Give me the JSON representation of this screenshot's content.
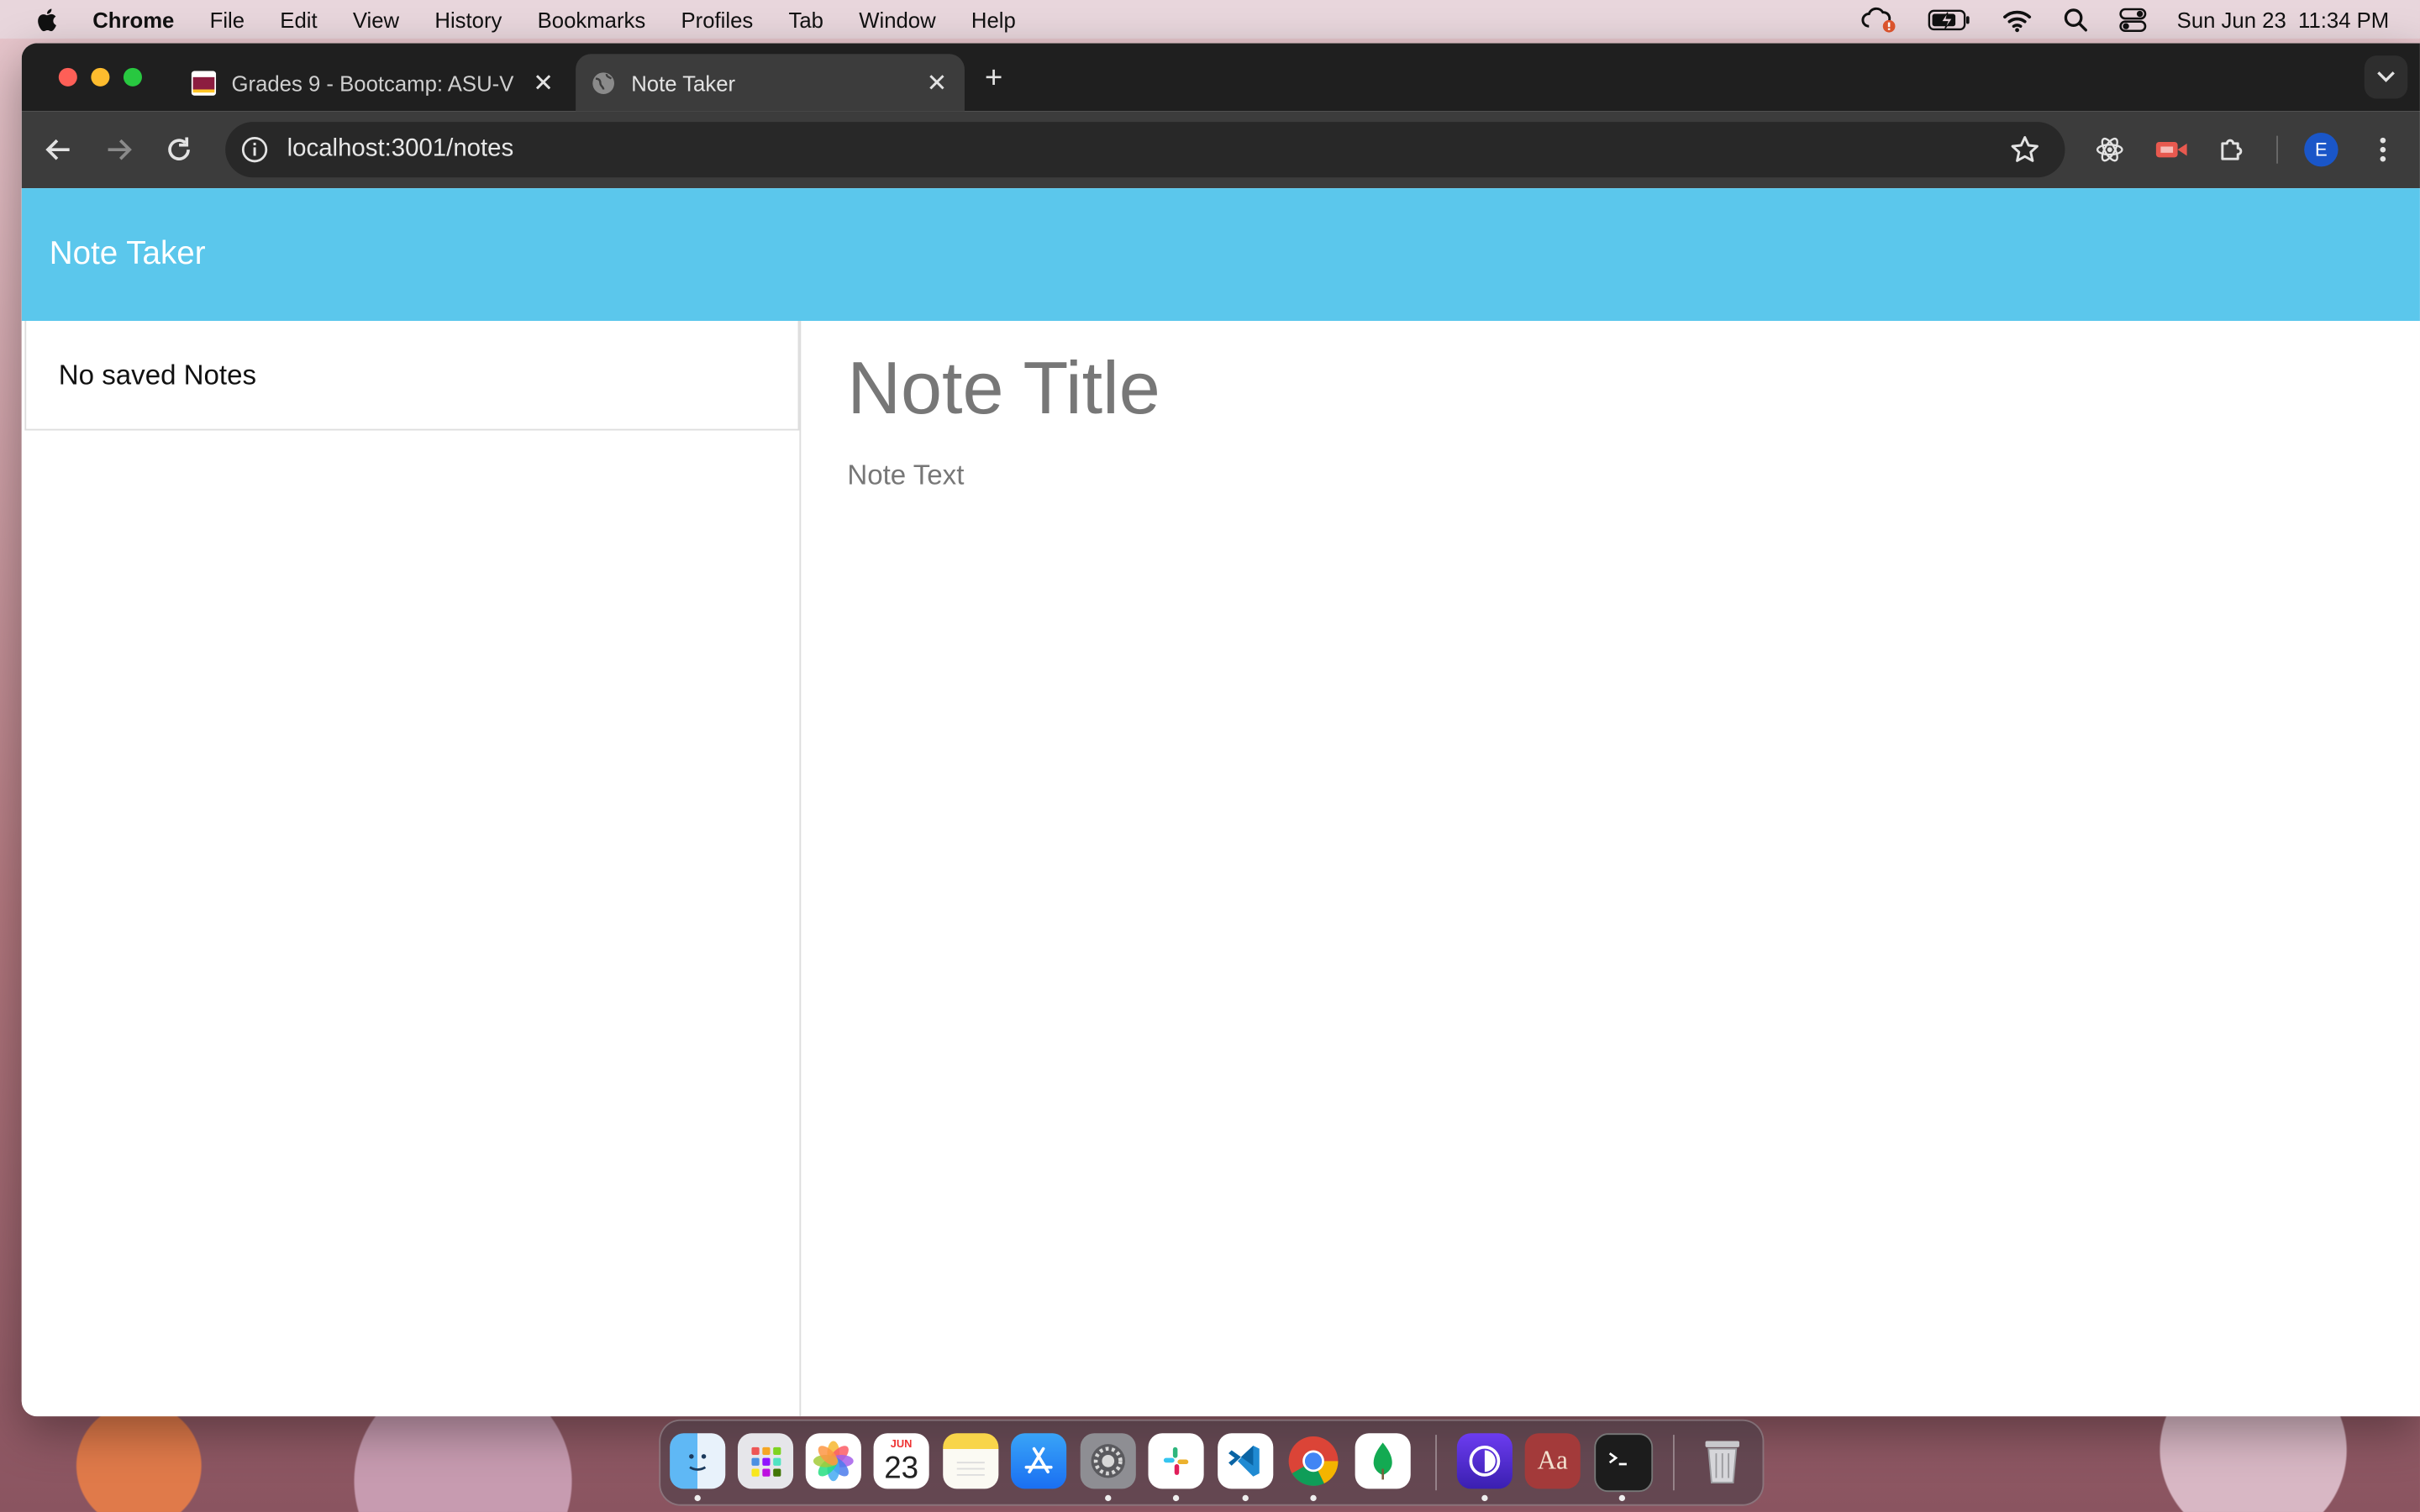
{
  "menubar": {
    "app_name": "Chrome",
    "items": [
      "File",
      "Edit",
      "View",
      "History",
      "Bookmarks",
      "Profiles",
      "Tab",
      "Window",
      "Help"
    ],
    "datetime": "Sun Jun 23  11:34 PM"
  },
  "tabs": [
    {
      "title": "Grades 9 - Bootcamp: ASU-V",
      "favicon": "asu-favicon",
      "active": false
    },
    {
      "title": "Note Taker",
      "favicon": "globe-icon",
      "active": true
    }
  ],
  "toolbar": {
    "url": "localhost:3001/notes",
    "profile_initial": "E"
  },
  "app": {
    "brand": "Note Taker",
    "empty_list_text": "No saved Notes",
    "title_placeholder": "Note Title",
    "text_placeholder": "Note Text",
    "navbar_color": "#5bc7ec"
  },
  "dock": {
    "apps": [
      "Finder",
      "Launchpad",
      "Photos",
      "Calendar",
      "Notes",
      "App Store",
      "System Settings",
      "Slack",
      "Visual Studio Code",
      "Google Chrome",
      "MongoDB Compass",
      "Tor Browser",
      "Dictionary",
      "Terminal",
      "Trash"
    ],
    "calendar_month": "JUN",
    "calendar_day": "23",
    "dictionary_label": "Aa"
  }
}
